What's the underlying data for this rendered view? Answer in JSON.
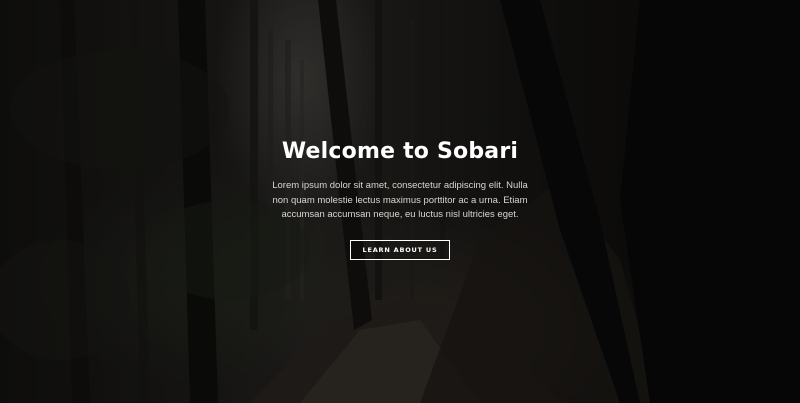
{
  "hero": {
    "title": "Welcome to Sobari",
    "description": "Lorem ipsum dolor sit amet, consectetur adipiscing elit. Nulla non quam molestie lectus maximus porttitor ac a urna. Etiam accumsan accumsan neque, eu luctus nisl ultricies eget.",
    "button_label": "LEARN ABOUT US"
  },
  "colors": {
    "title_text": "#ffffff",
    "body_text": "#d9d6d1",
    "button_border": "#ffffff",
    "background_dark": "#0b0a0a"
  }
}
